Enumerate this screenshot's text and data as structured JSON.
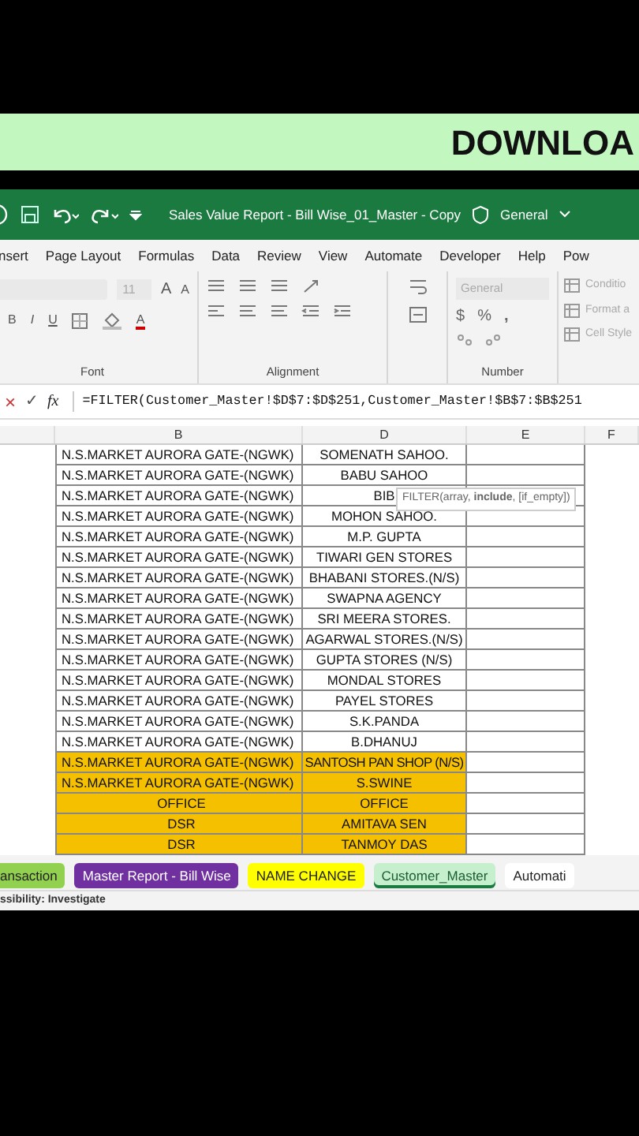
{
  "banner": {
    "text": "DOWNLOA"
  },
  "title_bar": {
    "title": "Sales Value Report - Bill Wise_01_Master - Copy",
    "sensitivity": "General"
  },
  "ribbon_tabs": [
    {
      "label": "nsert"
    },
    {
      "label": "Page Layout"
    },
    {
      "label": "Formulas"
    },
    {
      "label": "Data"
    },
    {
      "label": "Review"
    },
    {
      "label": "View"
    },
    {
      "label": "Automate"
    },
    {
      "label": "Developer"
    },
    {
      "label": "Help"
    },
    {
      "label": "Pow"
    }
  ],
  "ribbon": {
    "font_size": "11",
    "grow": "A",
    "shrink": "A",
    "bold": "B",
    "italic": "I",
    "underline": "U",
    "font_color": "A",
    "font_group": "Font",
    "alignment_group": "Alignment",
    "number_format": "General",
    "currency": "$",
    "percent": "%",
    "comma": ",",
    "number_group": "Number",
    "styles": [
      {
        "label": "Conditio"
      },
      {
        "label": "Format a"
      },
      {
        "label": "Cell Style"
      }
    ]
  },
  "formula_bar": {
    "cancel": "×",
    "enter": "✓",
    "fx": "fx",
    "formula": "=FILTER(Customer_Master!$D$7:$D$251,Customer_Master!$B$7:$B$251"
  },
  "tooltip": "FILTER(array, **include**, [if_empty])",
  "columns": [
    "B",
    "D",
    "E",
    "F"
  ],
  "rows": [
    {
      "b": "N.S.MARKET AURORA GATE-(NGWK)",
      "d": "SOMENATH SAHOO.",
      "highlighted": false
    },
    {
      "b": "N.S.MARKET AURORA GATE-(NGWK)",
      "d": "BABU SAHOO",
      "highlighted": false
    },
    {
      "b": "N.S.MARKET AURORA GATE-(NGWK)",
      "d": "BIB",
      "highlighted": false
    },
    {
      "b": "N.S.MARKET AURORA GATE-(NGWK)",
      "d": "MOHON SAHOO.",
      "highlighted": false
    },
    {
      "b": "N.S.MARKET AURORA GATE-(NGWK)",
      "d": "M.P. GUPTA",
      "highlighted": false
    },
    {
      "b": "N.S.MARKET AURORA GATE-(NGWK)",
      "d": "TIWARI GEN STORES",
      "highlighted": false
    },
    {
      "b": "N.S.MARKET AURORA GATE-(NGWK)",
      "d": "BHABANI STORES.(N/S)",
      "highlighted": false
    },
    {
      "b": "N.S.MARKET AURORA GATE-(NGWK)",
      "d": "SWAPNA AGENCY",
      "highlighted": false
    },
    {
      "b": "N.S.MARKET AURORA GATE-(NGWK)",
      "d": "SRI MEERA STORES.",
      "highlighted": false
    },
    {
      "b": "N.S.MARKET AURORA GATE-(NGWK)",
      "d": "AGARWAL STORES.(N/S)",
      "highlighted": false
    },
    {
      "b": "N.S.MARKET AURORA GATE-(NGWK)",
      "d": "GUPTA STORES (N/S)",
      "highlighted": false
    },
    {
      "b": "N.S.MARKET AURORA GATE-(NGWK)",
      "d": "MONDAL STORES",
      "highlighted": false
    },
    {
      "b": "N.S.MARKET AURORA GATE-(NGWK)",
      "d": "PAYEL STORES",
      "highlighted": false
    },
    {
      "b": "N.S.MARKET AURORA GATE-(NGWK)",
      "d": "S.K.PANDA",
      "highlighted": false
    },
    {
      "b": "N.S.MARKET AURORA GATE-(NGWK)",
      "d": "B.DHANUJ",
      "highlighted": false
    },
    {
      "b": "N.S.MARKET AURORA GATE-(NGWK)",
      "d": "SANTOSH PAN SHOP (N/S)",
      "highlighted": true
    },
    {
      "b": "N.S.MARKET AURORA GATE-(NGWK)",
      "d": "S.SWINE",
      "highlighted": true
    },
    {
      "b": "OFFICE",
      "d": "OFFICE",
      "highlighted": true
    },
    {
      "b": "DSR",
      "d": "AMITAVA SEN",
      "highlighted": true
    },
    {
      "b": "DSR",
      "d": "TANMOY DAS",
      "highlighted": true
    }
  ],
  "sheet_tabs": [
    {
      "label": "ansaction",
      "color": "#92d050",
      "selected": false
    },
    {
      "label": "Master Report - Bill Wise",
      "color": "#7030a0",
      "selected": false
    },
    {
      "label": "NAME CHANGE",
      "color": "#ffff00",
      "selected": false
    },
    {
      "label": "Customer_Master",
      "color": "#c6efce",
      "selected": true
    },
    {
      "label": "Automati",
      "color": "#ffffff",
      "selected": false
    }
  ],
  "status_bar": {
    "text": "ssibility: Investigate"
  }
}
